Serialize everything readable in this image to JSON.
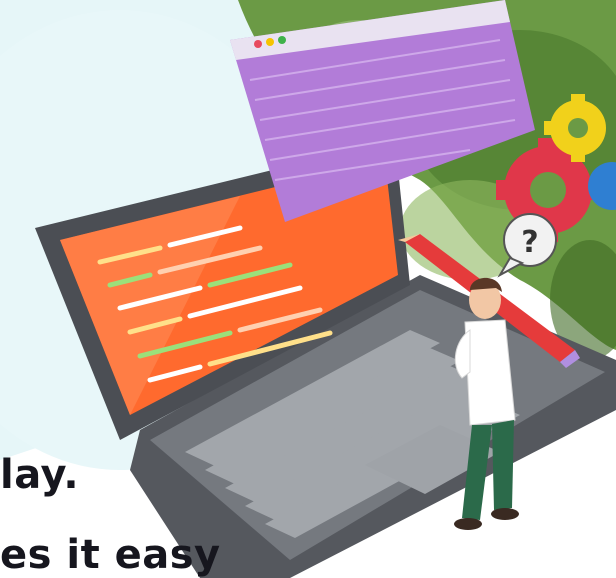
{
  "headline": {
    "line1": "lay.",
    "line2": "es it easy"
  },
  "colors": {
    "bg_blob": "#e6f6f8",
    "green": "#5f8a3c",
    "laptop_body": "#5a5d63",
    "keyboard": "#8f9399",
    "screen": "#ff6b35",
    "code_window": "#b07ad6",
    "gear_red": "#e23b4a",
    "gear_yellow": "#f1d11b",
    "gear_blue": "#2f7fd2",
    "pencil": "#e53b3b",
    "text": "#16161e"
  },
  "icons": [
    "question-mark-icon",
    "gear-icon",
    "pencil-icon"
  ]
}
